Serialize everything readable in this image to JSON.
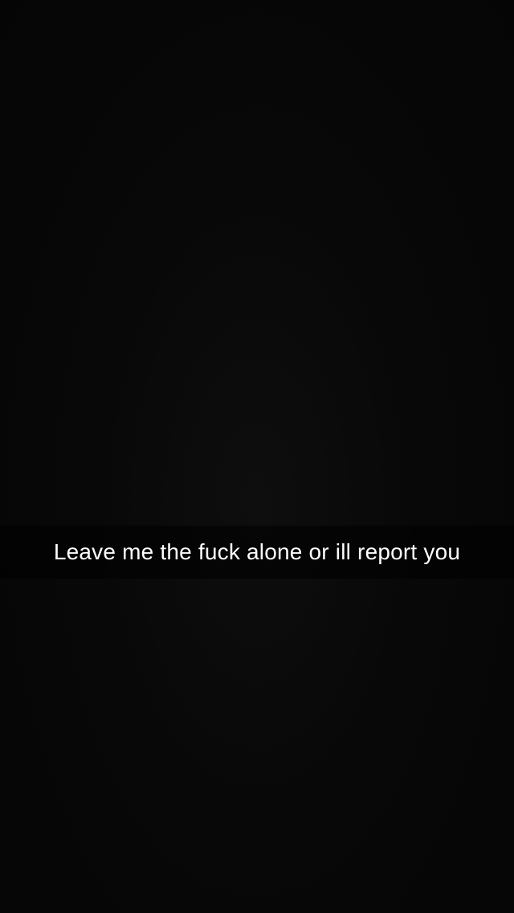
{
  "snap": {
    "caption": "Leave me the fuck alone or ill report you"
  },
  "colors": {
    "background": "#070707",
    "caption_text": "#ffffff"
  }
}
